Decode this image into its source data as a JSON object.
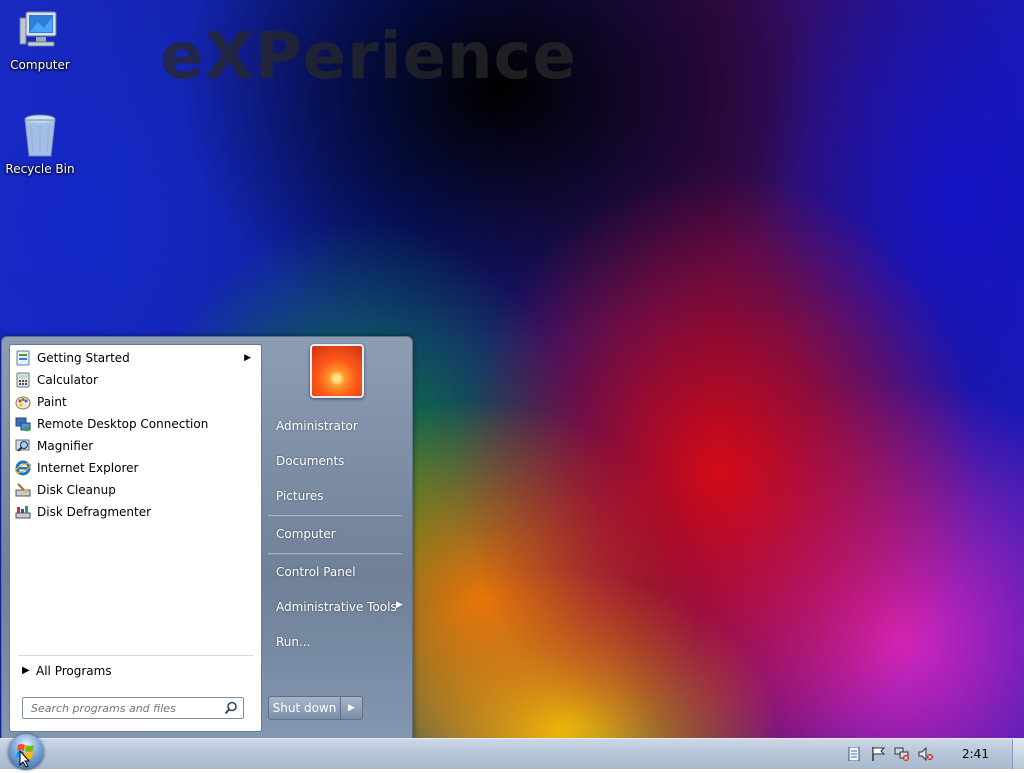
{
  "desktop": {
    "watermark": "eXPerience",
    "icons": [
      {
        "label": "Computer",
        "icon": "computer-icon"
      },
      {
        "label": "Recycle Bin",
        "icon": "recycle-bin-icon"
      }
    ]
  },
  "start_menu": {
    "programs": [
      {
        "label": "Getting Started",
        "icon": "getting-started-icon",
        "has_submenu": true
      },
      {
        "label": "Calculator",
        "icon": "calculator-icon"
      },
      {
        "label": "Paint",
        "icon": "paint-icon"
      },
      {
        "label": "Remote Desktop Connection",
        "icon": "remote-desktop-icon"
      },
      {
        "label": "Magnifier",
        "icon": "magnifier-icon"
      },
      {
        "label": "Internet Explorer",
        "icon": "internet-explorer-icon"
      },
      {
        "label": "Disk Cleanup",
        "icon": "disk-cleanup-icon"
      },
      {
        "label": "Disk Defragmenter",
        "icon": "disk-defragmenter-icon"
      }
    ],
    "all_programs": "All Programs",
    "search_placeholder": "Search programs and files",
    "right_items": {
      "user": "Administrator",
      "documents": "Documents",
      "pictures": "Pictures",
      "computer": "Computer",
      "control_panel": "Control Panel",
      "admin_tools": "Administrative Tools",
      "run": "Run..."
    },
    "shutdown_label": "Shut down"
  },
  "taskbar": {
    "clock": "2:41",
    "tray_icons": [
      "notification-icon",
      "action-center-flag-icon",
      "network-icon",
      "volume-muted-icon"
    ]
  },
  "colors": {
    "menu_frame": "#7d8fa8",
    "taskbar": "#b5c4d8"
  }
}
